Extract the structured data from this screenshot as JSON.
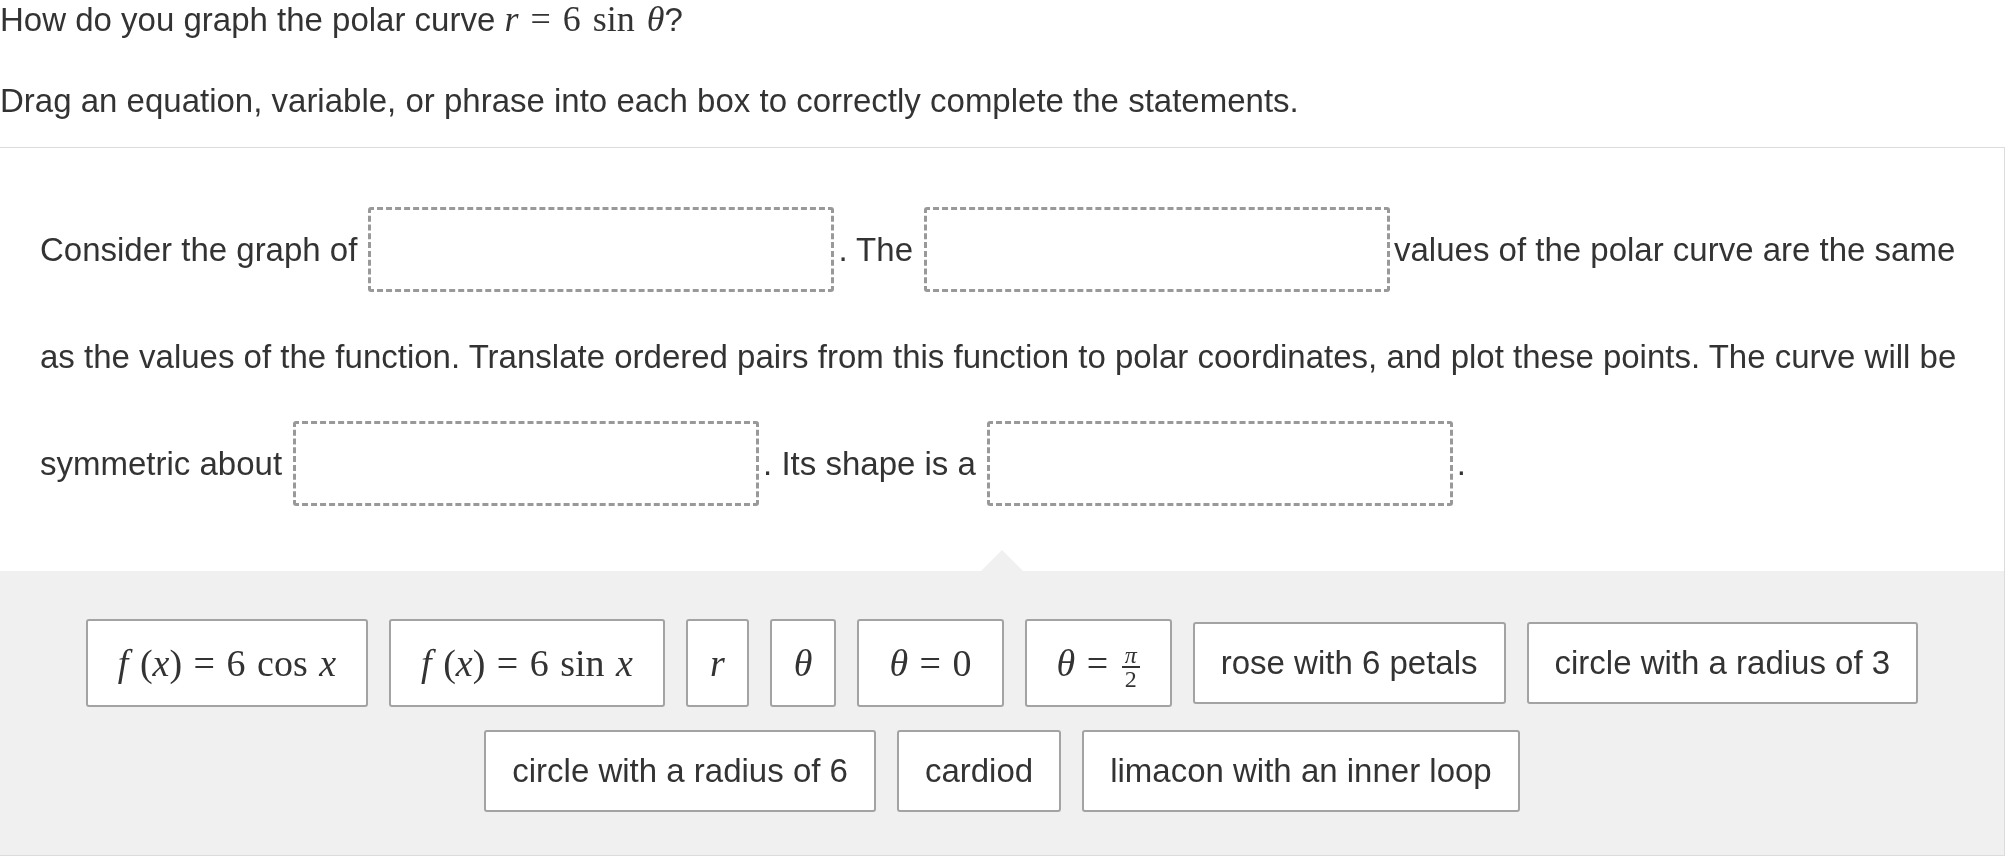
{
  "question": {
    "text": "How do you graph the polar curve",
    "math": "*r* = 6 sin *θ*",
    "end": "?"
  },
  "instruction": "Drag an equation, variable, or phrase into each box to correctly complete the statements.",
  "statement_lines": [
    {
      "parts": [
        {
          "kind": "text",
          "text": "Consider the graph of"
        },
        {
          "kind": "blank"
        },
        {
          "kind": "text",
          "text": ". The"
        },
        {
          "kind": "blank"
        },
        {
          "kind": "text",
          "text": "values of the polar curve are the same"
        }
      ]
    },
    {
      "parts": [
        {
          "kind": "text",
          "text": "as the values of the function. Translate ordered pairs from this function to polar coordinates, and plot these points. The curve will be"
        }
      ]
    },
    {
      "parts": [
        {
          "kind": "text",
          "text": "symmetric about"
        },
        {
          "kind": "blank"
        },
        {
          "kind": "text",
          "text": ". Its shape is a"
        },
        {
          "kind": "blank"
        },
        {
          "kind": "text",
          "text": "."
        }
      ]
    }
  ],
  "tiles": [
    {
      "kind": "math",
      "text": "*f* (*x*) = 6 cos *x*"
    },
    {
      "kind": "math",
      "text": "*f* (*x*) = 6 sin *x*"
    },
    {
      "kind": "variable",
      "text": "r"
    },
    {
      "kind": "variable",
      "text": "θ"
    },
    {
      "kind": "math",
      "text": "*θ* = 0"
    },
    {
      "kind": "fraction",
      "lhs": "*θ* =",
      "numerator": "π",
      "denominator": "2"
    },
    {
      "kind": "phrase",
      "text": "rose with 6 petals"
    },
    {
      "kind": "phrase",
      "text": "circle with a radius of 3"
    },
    {
      "kind": "phrase",
      "text": "circle with a radius of 6"
    },
    {
      "kind": "phrase",
      "text": "cardiod"
    },
    {
      "kind": "phrase",
      "text": "limacon with an inner loop"
    }
  ]
}
